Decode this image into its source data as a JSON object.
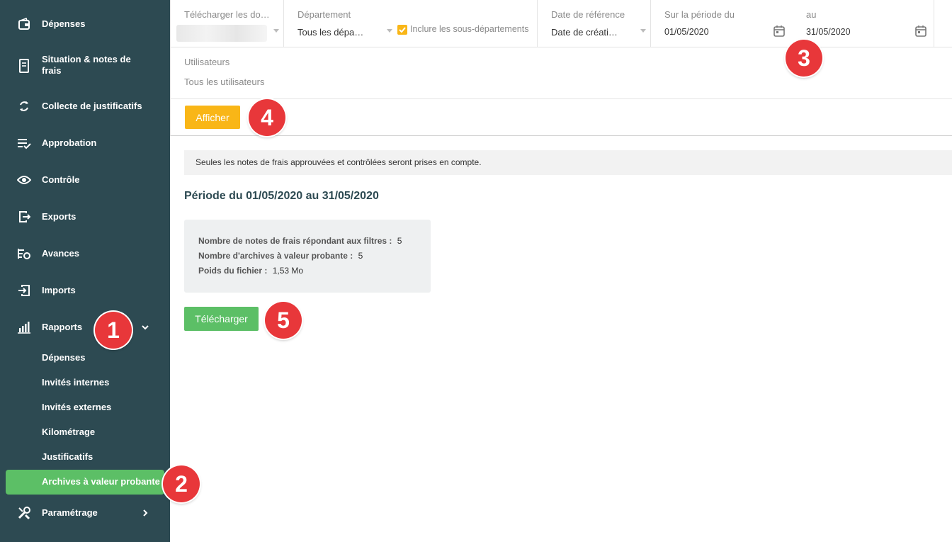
{
  "sidebar": {
    "items": [
      {
        "label": "Dépenses",
        "icon": "wallet-icon"
      },
      {
        "label": "Situation & notes de frais",
        "icon": "receipt-icon"
      },
      {
        "label": "Collecte de justificatifs",
        "icon": "sync-icon"
      },
      {
        "label": "Approbation",
        "icon": "list-check-icon"
      },
      {
        "label": "Contrôle",
        "icon": "eye-icon"
      },
      {
        "label": "Exports",
        "icon": "export-icon"
      },
      {
        "label": "Avances",
        "icon": "advance-icon"
      },
      {
        "label": "Imports",
        "icon": "import-icon"
      },
      {
        "label": "Rapports",
        "icon": "bar-chart-icon"
      },
      {
        "label": "Paramétrage",
        "icon": "tools-icon"
      }
    ],
    "sub_items": [
      {
        "label": "Dépenses"
      },
      {
        "label": "Invités internes"
      },
      {
        "label": "Invités externes"
      },
      {
        "label": "Kilométrage"
      },
      {
        "label": "Justificatifs"
      },
      {
        "label": "Archives à valeur probante"
      }
    ]
  },
  "filters": {
    "download": {
      "label": "Télécharger les do…",
      "value": ""
    },
    "department": {
      "label": "Département",
      "value": "Tous les dépa…",
      "include_sub_label": "Inclure les sous-départements"
    },
    "reference_date": {
      "label": "Date de référence",
      "value": "Date de créati…"
    },
    "period_from": {
      "label": "Sur la période du",
      "value": "01/05/2020"
    },
    "period_to": {
      "label": "au",
      "value": "31/05/2020"
    },
    "users": {
      "label": "Utilisateurs",
      "value": "Tous les utilisateurs"
    },
    "show_button": "Afficher"
  },
  "main": {
    "notice": "Seules les notes de frais approuvées et contrôlées seront prises en compte.",
    "period_title": "Période du 01/05/2020 au 31/05/2020",
    "stats": [
      {
        "label": "Nombre de notes de frais répondant aux filtres :",
        "value": "5"
      },
      {
        "label": "Nombre d'archives à valeur probante :",
        "value": "5"
      },
      {
        "label": "Poids du fichier :",
        "value": "1,53 Mo"
      }
    ],
    "download_button": "Télécharger"
  },
  "markers": [
    "1",
    "2",
    "3",
    "4",
    "5"
  ],
  "colors": {
    "sidebar_bg": "#2d4a52",
    "accent_green": "#5cbf66",
    "accent_orange": "#f9b617",
    "marker_red": "#e8373a"
  }
}
